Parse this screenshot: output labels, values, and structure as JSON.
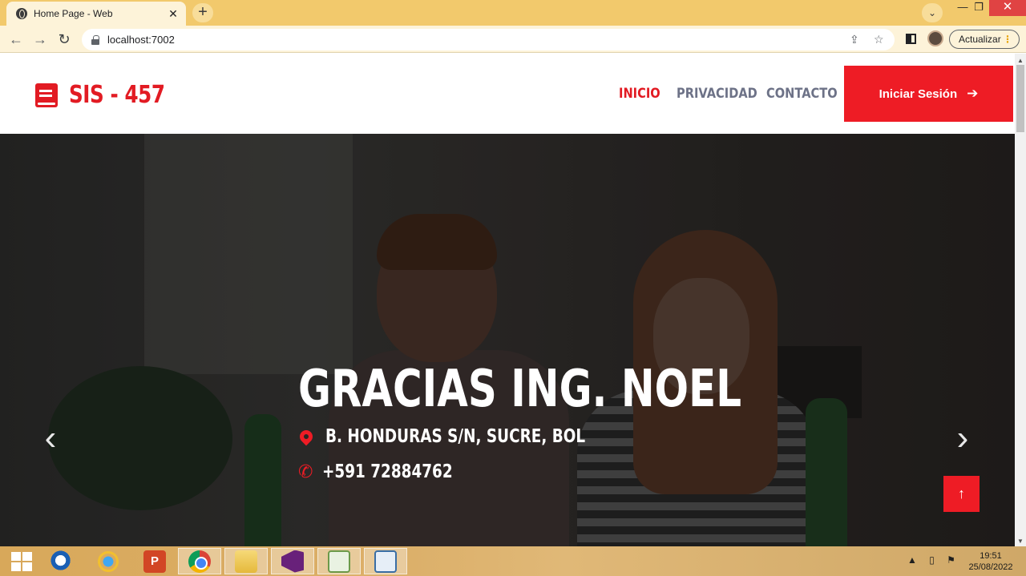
{
  "browser": {
    "tab_title": "Home Page - Web",
    "tab_close": "✕",
    "new_tab": "+",
    "url": "localhost:7002",
    "update_label": "Actualizar",
    "window_controls": {
      "minimize": "—",
      "maximize": "❐",
      "close": "✕"
    }
  },
  "header": {
    "brand": "SIS - 457",
    "nav": [
      {
        "label": "INICIO",
        "active": true
      },
      {
        "label": "PRIVACIDAD",
        "active": false
      },
      {
        "label": "CONTACTO",
        "active": false
      }
    ],
    "login_label": "Iniciar Sesión"
  },
  "hero": {
    "title": "GRACIAS ING. NOEL",
    "address": "B. HONDURAS S/N, SUCRE, BOL",
    "phone": "+591 72884762",
    "prev": "‹",
    "next": "›",
    "back_to_top": "↑"
  },
  "taskbar": {
    "time": "19:51",
    "date": "25/08/2022",
    "apps": [
      "windows-start",
      "search",
      "internet-explorer",
      "powerpoint",
      "chrome",
      "file-explorer",
      "visual-studio",
      "notepad-plus-plus",
      "app-window"
    ],
    "active_app": "chrome"
  },
  "icons": {
    "brand": "book-icon",
    "address": "map-pin-icon",
    "phone": "phone-icon",
    "login": "arrow-right-icon"
  },
  "colors": {
    "accent": "#ee1c25",
    "nav_inactive": "#6d7287",
    "chrome_frame": "#f2c96c"
  }
}
